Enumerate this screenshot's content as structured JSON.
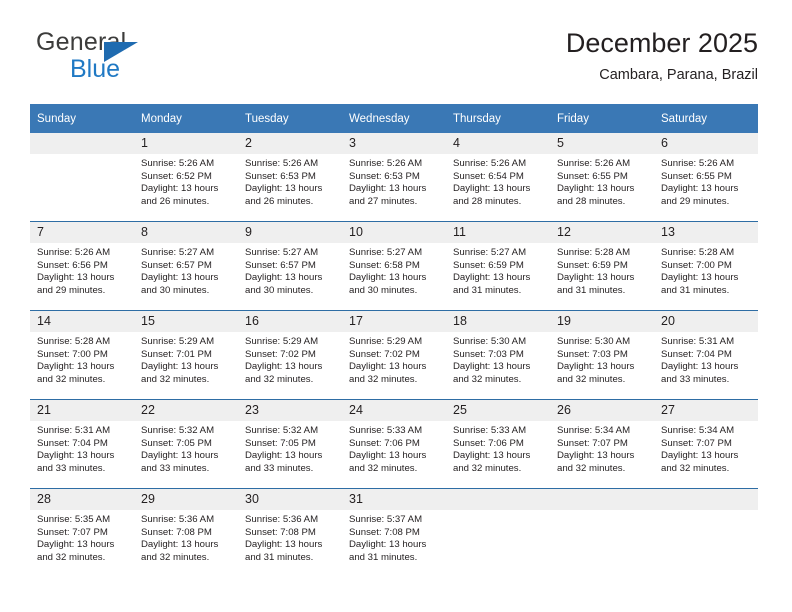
{
  "brand": {
    "name_part1": "General",
    "name_part2": "Blue",
    "triangle_color": "#1f6bb0",
    "blue_text_color": "#2079c4"
  },
  "header": {
    "title": "December 2025",
    "subtitle": "Cambara, Parana, Brazil",
    "header_bg": "#3a78b5",
    "daynum_bg": "#efefef",
    "week_divider_color": "#2e6da4"
  },
  "weekday_headers": [
    "Sunday",
    "Monday",
    "Tuesday",
    "Wednesday",
    "Thursday",
    "Friday",
    "Saturday"
  ],
  "weeks": [
    [
      {
        "day": "",
        "sunrise": "",
        "sunset": "",
        "daylight_line1": "",
        "daylight_line2": ""
      },
      {
        "day": "1",
        "sunrise": "Sunrise: 5:26 AM",
        "sunset": "Sunset: 6:52 PM",
        "daylight_line1": "Daylight: 13 hours",
        "daylight_line2": "and 26 minutes."
      },
      {
        "day": "2",
        "sunrise": "Sunrise: 5:26 AM",
        "sunset": "Sunset: 6:53 PM",
        "daylight_line1": "Daylight: 13 hours",
        "daylight_line2": "and 26 minutes."
      },
      {
        "day": "3",
        "sunrise": "Sunrise: 5:26 AM",
        "sunset": "Sunset: 6:53 PM",
        "daylight_line1": "Daylight: 13 hours",
        "daylight_line2": "and 27 minutes."
      },
      {
        "day": "4",
        "sunrise": "Sunrise: 5:26 AM",
        "sunset": "Sunset: 6:54 PM",
        "daylight_line1": "Daylight: 13 hours",
        "daylight_line2": "and 28 minutes."
      },
      {
        "day": "5",
        "sunrise": "Sunrise: 5:26 AM",
        "sunset": "Sunset: 6:55 PM",
        "daylight_line1": "Daylight: 13 hours",
        "daylight_line2": "and 28 minutes."
      },
      {
        "day": "6",
        "sunrise": "Sunrise: 5:26 AM",
        "sunset": "Sunset: 6:55 PM",
        "daylight_line1": "Daylight: 13 hours",
        "daylight_line2": "and 29 minutes."
      }
    ],
    [
      {
        "day": "7",
        "sunrise": "Sunrise: 5:26 AM",
        "sunset": "Sunset: 6:56 PM",
        "daylight_line1": "Daylight: 13 hours",
        "daylight_line2": "and 29 minutes."
      },
      {
        "day": "8",
        "sunrise": "Sunrise: 5:27 AM",
        "sunset": "Sunset: 6:57 PM",
        "daylight_line1": "Daylight: 13 hours",
        "daylight_line2": "and 30 minutes."
      },
      {
        "day": "9",
        "sunrise": "Sunrise: 5:27 AM",
        "sunset": "Sunset: 6:57 PM",
        "daylight_line1": "Daylight: 13 hours",
        "daylight_line2": "and 30 minutes."
      },
      {
        "day": "10",
        "sunrise": "Sunrise: 5:27 AM",
        "sunset": "Sunset: 6:58 PM",
        "daylight_line1": "Daylight: 13 hours",
        "daylight_line2": "and 30 minutes."
      },
      {
        "day": "11",
        "sunrise": "Sunrise: 5:27 AM",
        "sunset": "Sunset: 6:59 PM",
        "daylight_line1": "Daylight: 13 hours",
        "daylight_line2": "and 31 minutes."
      },
      {
        "day": "12",
        "sunrise": "Sunrise: 5:28 AM",
        "sunset": "Sunset: 6:59 PM",
        "daylight_line1": "Daylight: 13 hours",
        "daylight_line2": "and 31 minutes."
      },
      {
        "day": "13",
        "sunrise": "Sunrise: 5:28 AM",
        "sunset": "Sunset: 7:00 PM",
        "daylight_line1": "Daylight: 13 hours",
        "daylight_line2": "and 31 minutes."
      }
    ],
    [
      {
        "day": "14",
        "sunrise": "Sunrise: 5:28 AM",
        "sunset": "Sunset: 7:00 PM",
        "daylight_line1": "Daylight: 13 hours",
        "daylight_line2": "and 32 minutes."
      },
      {
        "day": "15",
        "sunrise": "Sunrise: 5:29 AM",
        "sunset": "Sunset: 7:01 PM",
        "daylight_line1": "Daylight: 13 hours",
        "daylight_line2": "and 32 minutes."
      },
      {
        "day": "16",
        "sunrise": "Sunrise: 5:29 AM",
        "sunset": "Sunset: 7:02 PM",
        "daylight_line1": "Daylight: 13 hours",
        "daylight_line2": "and 32 minutes."
      },
      {
        "day": "17",
        "sunrise": "Sunrise: 5:29 AM",
        "sunset": "Sunset: 7:02 PM",
        "daylight_line1": "Daylight: 13 hours",
        "daylight_line2": "and 32 minutes."
      },
      {
        "day": "18",
        "sunrise": "Sunrise: 5:30 AM",
        "sunset": "Sunset: 7:03 PM",
        "daylight_line1": "Daylight: 13 hours",
        "daylight_line2": "and 32 minutes."
      },
      {
        "day": "19",
        "sunrise": "Sunrise: 5:30 AM",
        "sunset": "Sunset: 7:03 PM",
        "daylight_line1": "Daylight: 13 hours",
        "daylight_line2": "and 32 minutes."
      },
      {
        "day": "20",
        "sunrise": "Sunrise: 5:31 AM",
        "sunset": "Sunset: 7:04 PM",
        "daylight_line1": "Daylight: 13 hours",
        "daylight_line2": "and 33 minutes."
      }
    ],
    [
      {
        "day": "21",
        "sunrise": "Sunrise: 5:31 AM",
        "sunset": "Sunset: 7:04 PM",
        "daylight_line1": "Daylight: 13 hours",
        "daylight_line2": "and 33 minutes."
      },
      {
        "day": "22",
        "sunrise": "Sunrise: 5:32 AM",
        "sunset": "Sunset: 7:05 PM",
        "daylight_line1": "Daylight: 13 hours",
        "daylight_line2": "and 33 minutes."
      },
      {
        "day": "23",
        "sunrise": "Sunrise: 5:32 AM",
        "sunset": "Sunset: 7:05 PM",
        "daylight_line1": "Daylight: 13 hours",
        "daylight_line2": "and 33 minutes."
      },
      {
        "day": "24",
        "sunrise": "Sunrise: 5:33 AM",
        "sunset": "Sunset: 7:06 PM",
        "daylight_line1": "Daylight: 13 hours",
        "daylight_line2": "and 32 minutes."
      },
      {
        "day": "25",
        "sunrise": "Sunrise: 5:33 AM",
        "sunset": "Sunset: 7:06 PM",
        "daylight_line1": "Daylight: 13 hours",
        "daylight_line2": "and 32 minutes."
      },
      {
        "day": "26",
        "sunrise": "Sunrise: 5:34 AM",
        "sunset": "Sunset: 7:07 PM",
        "daylight_line1": "Daylight: 13 hours",
        "daylight_line2": "and 32 minutes."
      },
      {
        "day": "27",
        "sunrise": "Sunrise: 5:34 AM",
        "sunset": "Sunset: 7:07 PM",
        "daylight_line1": "Daylight: 13 hours",
        "daylight_line2": "and 32 minutes."
      }
    ],
    [
      {
        "day": "28",
        "sunrise": "Sunrise: 5:35 AM",
        "sunset": "Sunset: 7:07 PM",
        "daylight_line1": "Daylight: 13 hours",
        "daylight_line2": "and 32 minutes."
      },
      {
        "day": "29",
        "sunrise": "Sunrise: 5:36 AM",
        "sunset": "Sunset: 7:08 PM",
        "daylight_line1": "Daylight: 13 hours",
        "daylight_line2": "and 32 minutes."
      },
      {
        "day": "30",
        "sunrise": "Sunrise: 5:36 AM",
        "sunset": "Sunset: 7:08 PM",
        "daylight_line1": "Daylight: 13 hours",
        "daylight_line2": "and 31 minutes."
      },
      {
        "day": "31",
        "sunrise": "Sunrise: 5:37 AM",
        "sunset": "Sunset: 7:08 PM",
        "daylight_line1": "Daylight: 13 hours",
        "daylight_line2": "and 31 minutes."
      },
      {
        "day": "",
        "sunrise": "",
        "sunset": "",
        "daylight_line1": "",
        "daylight_line2": ""
      },
      {
        "day": "",
        "sunrise": "",
        "sunset": "",
        "daylight_line1": "",
        "daylight_line2": ""
      },
      {
        "day": "",
        "sunrise": "",
        "sunset": "",
        "daylight_line1": "",
        "daylight_line2": ""
      }
    ]
  ]
}
